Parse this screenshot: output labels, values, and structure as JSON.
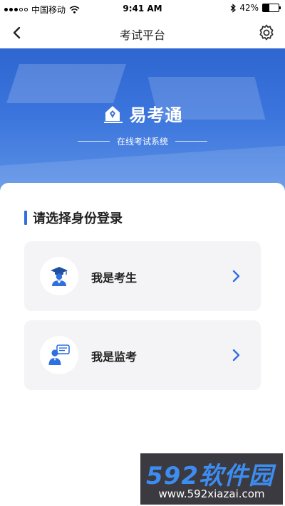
{
  "status_bar": {
    "carrier": "中国移动",
    "time": "9:41 AM",
    "battery": "42%",
    "battery_level": 0.42,
    "icons": [
      "signal-icon",
      "wifi-icon",
      "bluetooth-icon",
      "battery-icon"
    ]
  },
  "nav": {
    "title": "考试平台",
    "back_icon": "chevron-left-icon",
    "settings_icon": "gear-icon"
  },
  "banner": {
    "brand_name": "易考通",
    "brand_subtitle": "在线考试系统",
    "logo_icon": "pen-house-logo-icon"
  },
  "section": {
    "title": "请选择身份登录"
  },
  "roles": [
    {
      "label": "我是考生",
      "icon": "student-graduate-icon"
    },
    {
      "label": "我是监考",
      "icon": "proctor-chat-icon"
    }
  ],
  "colors": {
    "accent": "#2f6fe0",
    "banner": "#3a74dc",
    "card_bg": "#f4f4f6"
  },
  "watermark": {
    "main": "592软件园",
    "url": "www.592xiazai.com"
  }
}
